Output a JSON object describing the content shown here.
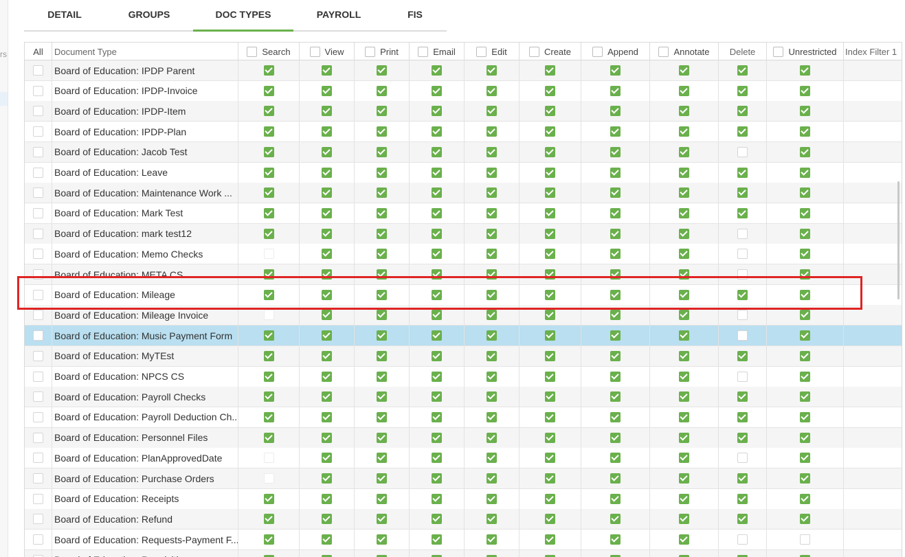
{
  "tabs": [
    {
      "label": "DETAIL",
      "active": false
    },
    {
      "label": "GROUPS",
      "active": false
    },
    {
      "label": "DOC TYPES",
      "active": true
    },
    {
      "label": "PAYROLL",
      "active": false
    },
    {
      "label": "FIS",
      "active": false
    }
  ],
  "left_fragment": "rs",
  "columns": {
    "all": "All",
    "document_type": "Document Type",
    "permissions": [
      "Search",
      "View",
      "Print",
      "Email",
      "Edit",
      "Create",
      "Append",
      "Annotate",
      "Delete",
      "Unrestricted"
    ],
    "index_filter": "Index Filter 1"
  },
  "rows": [
    {
      "name": "Board of Education: IPDP Parent",
      "perms": [
        1,
        1,
        1,
        1,
        1,
        1,
        1,
        1,
        1,
        1
      ]
    },
    {
      "name": "Board of Education: IPDP-Invoice",
      "perms": [
        1,
        1,
        1,
        1,
        1,
        1,
        1,
        1,
        1,
        1
      ]
    },
    {
      "name": "Board of Education: IPDP-Item",
      "perms": [
        1,
        1,
        1,
        1,
        1,
        1,
        1,
        1,
        1,
        1
      ]
    },
    {
      "name": "Board of Education: IPDP-Plan",
      "perms": [
        1,
        1,
        1,
        1,
        1,
        1,
        1,
        1,
        1,
        1
      ]
    },
    {
      "name": "Board of Education: Jacob Test",
      "perms": [
        1,
        1,
        1,
        1,
        1,
        1,
        1,
        1,
        0,
        1
      ]
    },
    {
      "name": "Board of Education: Leave",
      "perms": [
        1,
        1,
        1,
        1,
        1,
        1,
        1,
        1,
        1,
        1
      ]
    },
    {
      "name": "Board of Education: Maintenance Work ...",
      "perms": [
        1,
        1,
        1,
        1,
        1,
        1,
        1,
        1,
        1,
        1
      ]
    },
    {
      "name": "Board of Education: Mark Test",
      "perms": [
        1,
        1,
        1,
        1,
        1,
        1,
        1,
        1,
        1,
        1
      ]
    },
    {
      "name": "Board of Education: mark test12",
      "perms": [
        1,
        1,
        1,
        1,
        1,
        1,
        1,
        1,
        0,
        1
      ]
    },
    {
      "name": "Board of Education: Memo Checks",
      "perms": [
        0,
        1,
        1,
        1,
        1,
        1,
        1,
        1,
        0,
        1
      ]
    },
    {
      "name": "Board of Education: META CS",
      "perms": [
        1,
        1,
        1,
        1,
        1,
        1,
        1,
        1,
        0,
        1
      ]
    },
    {
      "name": "Board of Education: Mileage",
      "perms": [
        1,
        1,
        1,
        1,
        1,
        1,
        1,
        1,
        1,
        1
      ]
    },
    {
      "name": "Board of Education: Mileage Invoice",
      "perms": [
        0,
        1,
        1,
        1,
        1,
        1,
        1,
        1,
        0,
        1
      ]
    },
    {
      "name": "Board of Education: Music Payment Form",
      "perms": [
        1,
        1,
        1,
        1,
        1,
        1,
        1,
        1,
        0,
        1
      ],
      "selected": true
    },
    {
      "name": "Board of Education: MyTEst",
      "perms": [
        1,
        1,
        1,
        1,
        1,
        1,
        1,
        1,
        1,
        1
      ]
    },
    {
      "name": "Board of Education: NPCS CS",
      "perms": [
        1,
        1,
        1,
        1,
        1,
        1,
        1,
        1,
        0,
        1
      ]
    },
    {
      "name": "Board of Education: Payroll Checks",
      "perms": [
        1,
        1,
        1,
        1,
        1,
        1,
        1,
        1,
        1,
        1
      ]
    },
    {
      "name": "Board of Education: Payroll Deduction Ch...",
      "perms": [
        1,
        1,
        1,
        1,
        1,
        1,
        1,
        1,
        1,
        1
      ]
    },
    {
      "name": "Board of Education: Personnel Files",
      "perms": [
        1,
        1,
        1,
        1,
        1,
        1,
        1,
        1,
        1,
        1
      ]
    },
    {
      "name": "Board of Education: PlanApprovedDate",
      "perms": [
        0,
        1,
        1,
        1,
        1,
        1,
        1,
        1,
        0,
        1
      ]
    },
    {
      "name": "Board of Education: Purchase Orders",
      "perms": [
        0,
        1,
        1,
        1,
        1,
        1,
        1,
        1,
        1,
        1
      ]
    },
    {
      "name": "Board of Education: Receipts",
      "perms": [
        1,
        1,
        1,
        1,
        1,
        1,
        1,
        1,
        1,
        1
      ]
    },
    {
      "name": "Board of Education: Refund",
      "perms": [
        1,
        1,
        1,
        1,
        1,
        1,
        1,
        1,
        1,
        1
      ]
    },
    {
      "name": "Board of Education: Requests-Payment F...",
      "perms": [
        1,
        1,
        1,
        1,
        1,
        1,
        1,
        1,
        0,
        0
      ]
    },
    {
      "name": "Board of Education: Requisitions",
      "perms": [
        1,
        1,
        1,
        1,
        1,
        1,
        1,
        1,
        1,
        1
      ]
    }
  ],
  "colors": {
    "checked": "#6ab04c",
    "selected_row": "#b9dff0",
    "annotation": "#e02424"
  }
}
